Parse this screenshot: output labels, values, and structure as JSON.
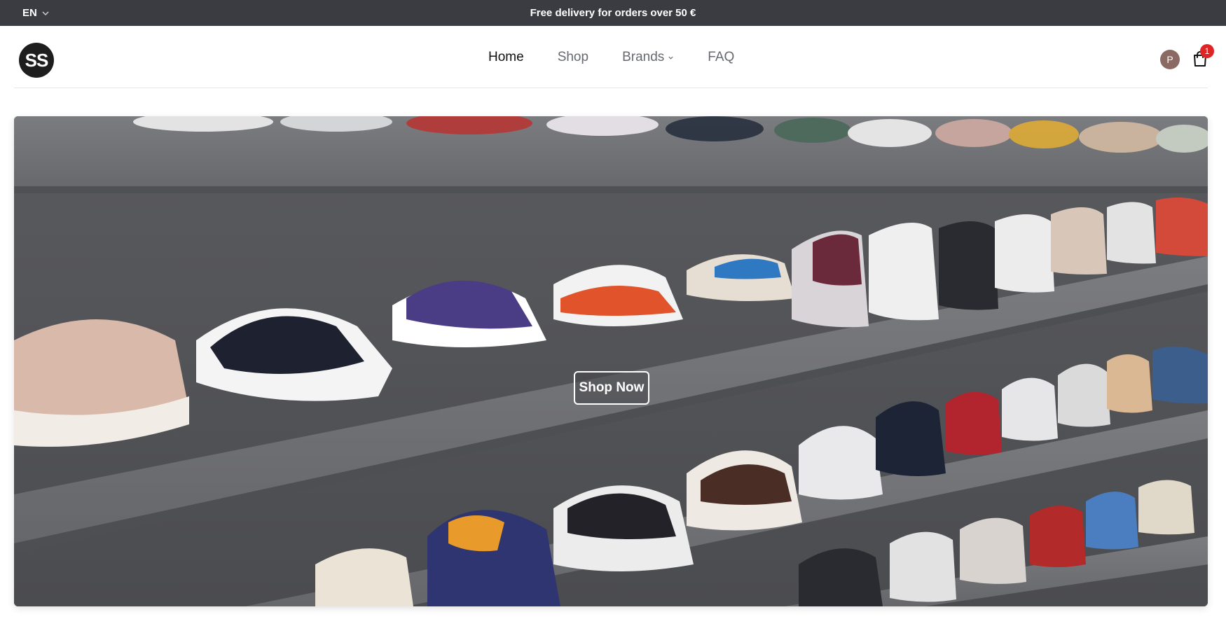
{
  "topbar": {
    "language": "EN",
    "announcement": "Free delivery for orders over 50 €"
  },
  "header": {
    "logo_text": "SS",
    "nav": [
      {
        "label": "Home",
        "active": true
      },
      {
        "label": "Shop",
        "active": false
      },
      {
        "label": "Brands",
        "active": false,
        "has_dropdown": true
      },
      {
        "label": "FAQ",
        "active": false
      }
    ],
    "account_initial": "P",
    "cart_count": "1"
  },
  "hero": {
    "cta_label": "Shop Now"
  },
  "icons": {
    "language_chevron": "chevron-down-icon",
    "brands_chevron": "chevron-down-icon",
    "cart": "shopping-bag-icon"
  },
  "colors": {
    "topbar_bg": "#3a3c42",
    "avatar_bg": "#8a6a62",
    "badge_bg": "#e02424",
    "shelf": "#707176",
    "wall": "#56575b"
  }
}
